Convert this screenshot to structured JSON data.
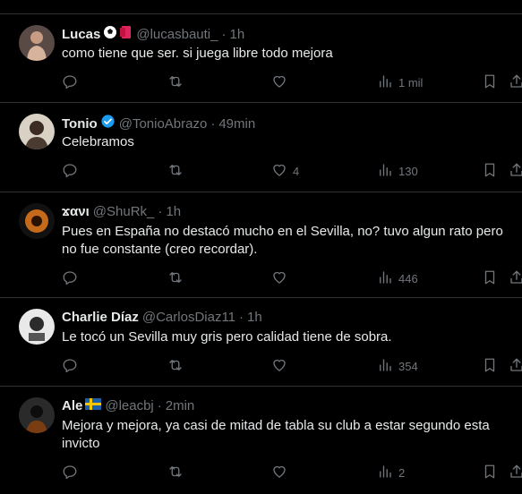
{
  "tweets": [
    {
      "name": "Lucas",
      "handle": "@lucasbauti_",
      "time": "1h",
      "text": "como tiene que ser. si juega libre todo mejora",
      "replies": "",
      "retweets": "",
      "likes": "",
      "views": "1 mil",
      "badges": [
        "soccer-ball-icon",
        "red-card-icon"
      ]
    },
    {
      "name": "Tonio",
      "handle": "@TonioAbrazo",
      "time": "49min",
      "text": "Celebramos",
      "replies": "",
      "retweets": "",
      "likes": "4",
      "views": "130",
      "badges": [
        "verified-badge-icon"
      ]
    },
    {
      "name": "ϫανι",
      "handle": "@ShuRk_",
      "time": "1h",
      "text": "Pues en España no destacó mucho en el Sevilla, no? tuvo algun rato pero no fue constante (creo recordar).",
      "replies": "",
      "retweets": "",
      "likes": "",
      "views": "446",
      "badges": []
    },
    {
      "name": "Charlie Díaz",
      "handle": "@CarlosDiaz11",
      "time": "1h",
      "text": "Le tocó un Sevilla muy gris pero calidad tiene de sobra.",
      "replies": "",
      "retweets": "",
      "likes": "",
      "views": "354",
      "badges": []
    },
    {
      "name": "Ale",
      "handle": "@leacbj",
      "time": "2min",
      "text": "Mejora y mejora, ya casi de mitad de tabla su club a estar segundo esta invicto",
      "replies": "",
      "retweets": "",
      "likes": "",
      "views": "2",
      "badges": [
        "sweden-flag-icon"
      ]
    }
  ],
  "separator": "·",
  "icons": {
    "reply": "reply-icon",
    "retweet": "retweet-icon",
    "like": "heart-icon",
    "views": "views-icon",
    "bookmark": "bookmark-icon",
    "share": "share-icon"
  },
  "colors": {
    "background": "#000000",
    "text": "#e7e9ea",
    "muted": "#71767b",
    "divider": "#2f3336",
    "verified": "#1d9bf0"
  }
}
